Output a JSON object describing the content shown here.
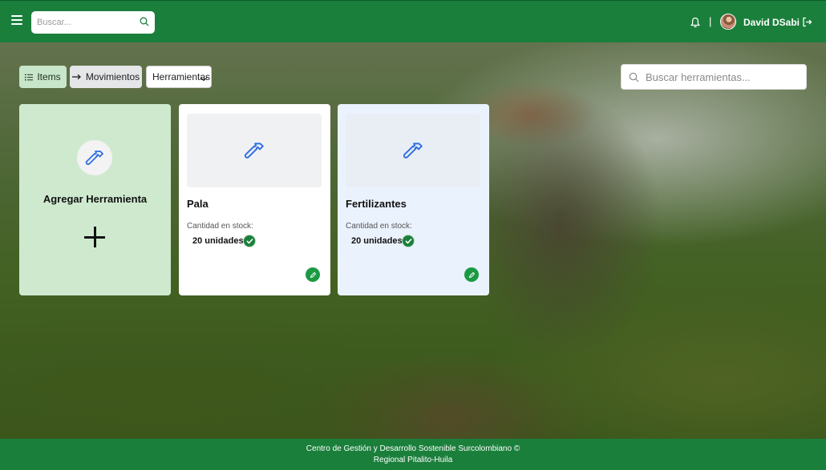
{
  "header": {
    "search_placeholder": "Buscar...",
    "separator": "|",
    "username": "David DSabi"
  },
  "toolbar": {
    "items_label": "Items",
    "movimientos_label": "Movimientos",
    "category_selected": "Herramientas",
    "search_placeholder": "Buscar herramientas..."
  },
  "add_card": {
    "title": "Agregar Herramienta"
  },
  "tools": [
    {
      "name": "Pala",
      "stock_label": "Cantidad en stock:",
      "stock_value": "20 unidades"
    },
    {
      "name": "Fertilizantes",
      "stock_label": "Cantidad en stock:",
      "stock_value": "20 unidades"
    }
  ],
  "footer": {
    "line1": "Centro de Gestión y Desarrollo Sostenible Surcolombiano ©",
    "line2": "Regional Pitalito-Huila"
  },
  "colors": {
    "primary_green": "#1b7f3c",
    "add_card_bg": "#cfe9cf",
    "icon_blue": "#2f6fe0"
  },
  "icons": {
    "menu": "menu-icon",
    "search": "search-icon",
    "bell": "bell-icon",
    "logout": "logout-icon",
    "list": "list-icon",
    "arrow": "arrow-right-icon",
    "hammer": "hammer-icon",
    "plus": "plus-icon",
    "check": "check-icon",
    "edit": "pencil-icon"
  }
}
